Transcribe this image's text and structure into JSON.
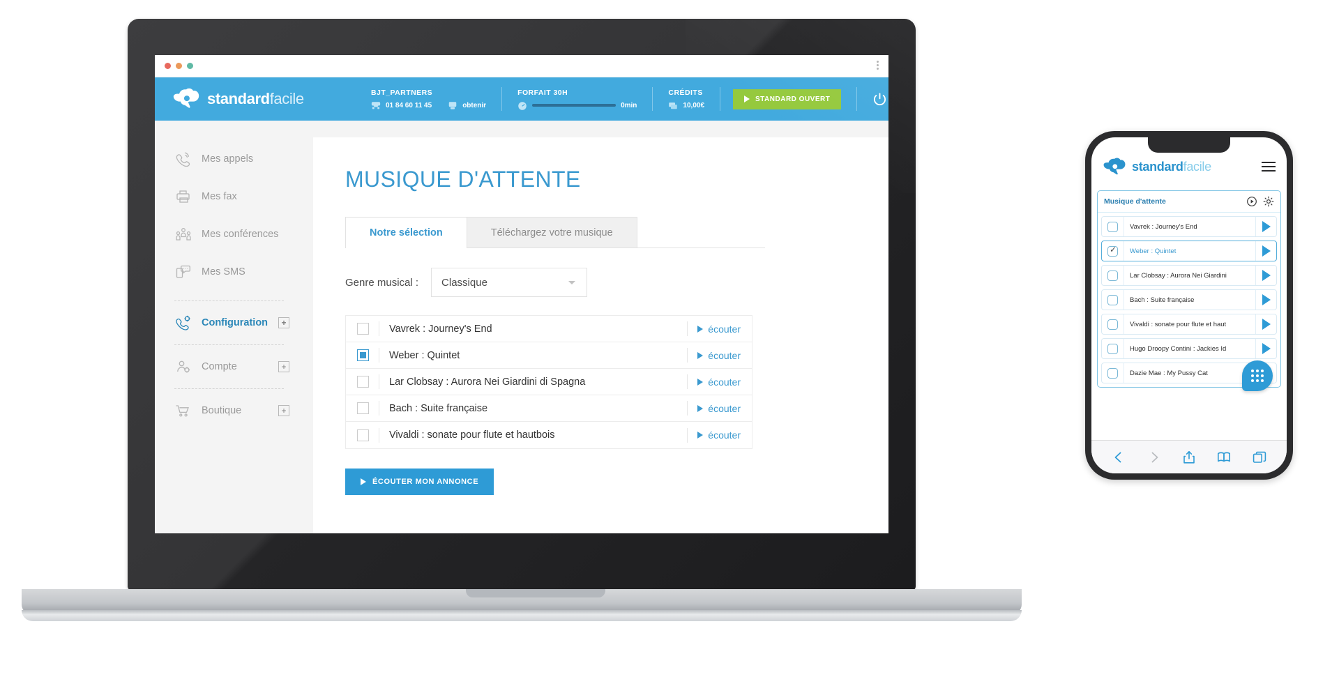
{
  "brand": {
    "accent": "#42aade",
    "green": "#95c93d",
    "blue_dark": "#2b87b8",
    "logo_bold": "standard",
    "logo_light": "facile"
  },
  "browser": {
    "dots": [
      "close",
      "minimize",
      "maximize"
    ],
    "menu_icon": "kebab-menu-icon"
  },
  "header": {
    "account": {
      "title": "BJT_PARTNERS",
      "phone": "01 84 60 11 45",
      "obtain_label": "obtenir"
    },
    "plan": {
      "title": "FORFAIT 30H",
      "usage": "0min"
    },
    "credits": {
      "title": "CRÉDITS",
      "amount": "10,00€"
    },
    "status_button": "STANDARD OUVERT",
    "power_icon": "power-icon"
  },
  "sidebar": {
    "items": [
      {
        "label": "Mes appels",
        "icon": "phone-waves-icon",
        "active": false,
        "expandable": false
      },
      {
        "label": "Mes fax",
        "icon": "printer-icon",
        "active": false,
        "expandable": false
      },
      {
        "label": "Mes conférences",
        "icon": "people-group-icon",
        "active": false,
        "expandable": false
      },
      {
        "label": "Mes SMS",
        "icon": "sms-bubble-icon",
        "active": false,
        "expandable": false
      },
      {
        "label": "Configuration",
        "icon": "phone-gear-icon",
        "active": true,
        "expandable": true
      },
      {
        "label": "Compte",
        "icon": "user-gear-icon",
        "active": false,
        "expandable": true
      },
      {
        "label": "Boutique",
        "icon": "shopping-cart-icon",
        "active": false,
        "expandable": true
      }
    ],
    "expand_symbol": "+"
  },
  "main": {
    "page_title": "MUSIQUE D'ATTENTE",
    "tabs": [
      {
        "label": "Notre sélection",
        "active": true
      },
      {
        "label": "Téléchargez votre musique",
        "active": false
      }
    ],
    "filter": {
      "label": "Genre musical :",
      "value": "Classique"
    },
    "tracks": [
      {
        "name": "Vavrek : Journey's End",
        "checked": false,
        "listen": "écouter"
      },
      {
        "name": "Weber : Quintet",
        "checked": true,
        "listen": "écouter"
      },
      {
        "name": "Lar Clobsay : Aurora Nei Giardini di Spagna",
        "checked": false,
        "listen": "écouter"
      },
      {
        "name": "Bach : Suite française",
        "checked": false,
        "listen": "écouter"
      },
      {
        "name": "Vivaldi : sonate pour flute et hautbois",
        "checked": false,
        "listen": "écouter"
      }
    ],
    "primary_button": "ÉCOUTER MON ANNONCE"
  },
  "phone": {
    "logo_bold": "standard",
    "logo_light": "facile",
    "menu_icon": "hamburger-icon",
    "panel_title": "Musique d'attente",
    "panel_icons": [
      "play-circle-icon",
      "gear-icon"
    ],
    "tracks": [
      {
        "name": "Vavrek : Journey's End",
        "checked": false
      },
      {
        "name": "Weber : Quintet",
        "checked": true
      },
      {
        "name": "Lar Clobsay : Aurora Nei Giardini",
        "checked": false
      },
      {
        "name": "Bach : Suite française",
        "checked": false
      },
      {
        "name": "Vivaldi : sonate pour flute et haut",
        "checked": false
      },
      {
        "name": "Hugo Droopy Contini : Jackies Id",
        "checked": false
      },
      {
        "name": "Dazie Mae : My Pussy Cat",
        "checked": false
      }
    ],
    "fab_icon": "dialpad-icon",
    "toolbar_icons": [
      "back-arrow-icon",
      "forward-arrow-icon",
      "share-icon",
      "bookmarks-icon",
      "tabs-icon"
    ]
  }
}
